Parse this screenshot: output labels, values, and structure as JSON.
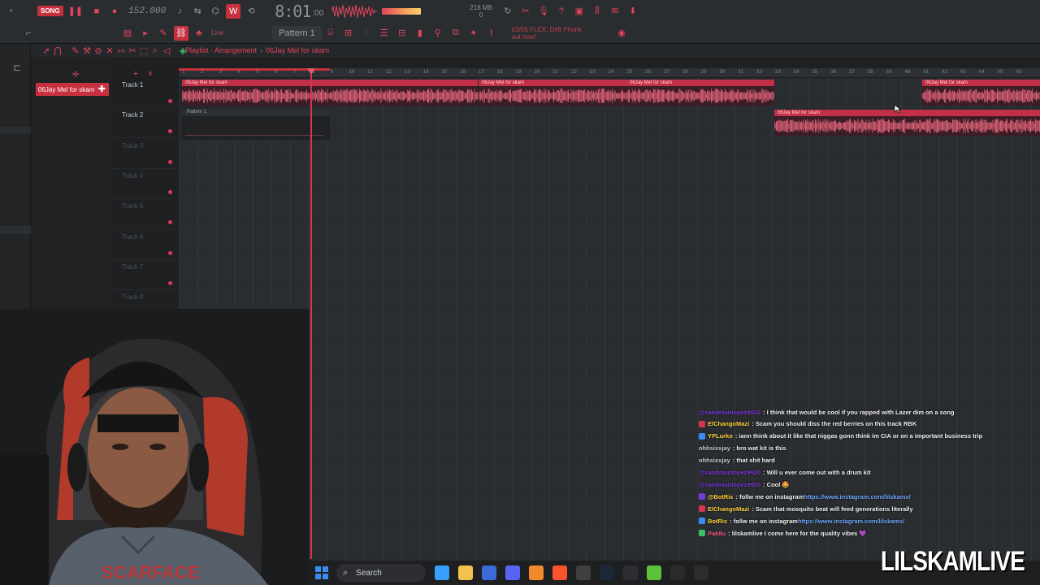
{
  "toolbar": {
    "song_label": "SONG",
    "bpm": "152.000",
    "clock_main": "8:01",
    "clock_sub": ":00",
    "memory_top": "218 MB",
    "memory_bottom": "0",
    "line_mode": "Line",
    "pattern_selector": "Pattern 1",
    "hint_line1": "03/06  FLEX: Drift Phonk",
    "hint_line2": "out now!"
  },
  "playlist": {
    "title": "Playlist - Arrangement",
    "separator": "›",
    "subtitle": "06Jay Mel for skam",
    "selected_clip": "06Jay Mel for skam"
  },
  "ruler_ticks": [
    "1",
    "2",
    "3",
    "4",
    "5",
    "6",
    "7",
    "8",
    "9",
    "10",
    "11",
    "12",
    "13",
    "14",
    "15",
    "16",
    "17",
    "18",
    "19",
    "20",
    "21",
    "22",
    "23",
    "24",
    "25",
    "26",
    "27",
    "28",
    "29",
    "30",
    "31",
    "32",
    "33",
    "34",
    "35",
    "36",
    "37",
    "38",
    "39",
    "40",
    "41",
    "42",
    "43",
    "44",
    "45",
    "46"
  ],
  "tracks": [
    {
      "name": "Track 1"
    },
    {
      "name": "Track 2"
    },
    {
      "name": "Track 3"
    },
    {
      "name": "Track 4"
    },
    {
      "name": "Track 5"
    },
    {
      "name": "Track 6"
    },
    {
      "name": "Track 7"
    },
    {
      "name": "Track 8"
    }
  ],
  "clips": {
    "audio_label": "06Jay Mel for skam",
    "pattern_label": "Pattern 1"
  },
  "chat": [
    {
      "user": "@sandmanlopez9920",
      "user_color": "#7b3ad6",
      "msg": ": I think that would be cool if you rapped with Lazer dim on a song"
    },
    {
      "user": "ElChangoMazi",
      "user_color": "#ffd23f",
      "badge": "#d8354f",
      "msg": ": Scam you should diss the red berries on this track RBK"
    },
    {
      "user": "YPLurko",
      "user_color": "#ffd23f",
      "badge": "#3b8df1",
      "msg": ": iann think about it like that niggas gonn think im CIA or on a important business trip"
    },
    {
      "user": "ohhsixxjay",
      "user_color": "#d0d0d0",
      "msg": ": bro wat kit is this"
    },
    {
      "user": "ohhsixxjay",
      "user_color": "#d0d0d0",
      "msg": ": that shit hard"
    },
    {
      "user": "@sandmanlopez9920",
      "user_color": "#7b3ad6",
      "msg": ": Will u ever come out with a drum kit"
    },
    {
      "user": "@sandmanlopez9920",
      "user_color": "#7b3ad6",
      "msg": ": Cool 🤩"
    },
    {
      "user": "@BotRix",
      "user_color": "#ffd23f",
      "badge": "#6c3fd6",
      "msg": ": follw me on instagram ",
      "link": "https://www.instagram.com/lilskamx/"
    },
    {
      "user": "ElChangoMazi",
      "user_color": "#ffd23f",
      "badge": "#d8354f",
      "msg": ": Scam that mosquito beat will feed generations literally"
    },
    {
      "user": "BotRix",
      "user_color": "#ffd23f",
      "badge": "#3b8df1",
      "msg": ": follw me on instagram ",
      "link": "https://www.instagram.com/lilskamx/"
    },
    {
      "user": "Pak8u",
      "user_color": "#ff5a8a",
      "badge": "#35c46a",
      "msg": ": lilskamlive I come here for the quality vibes 💜"
    }
  ],
  "taskbar": {
    "search_label": "Search",
    "apps": [
      "copilot-icon",
      "file-explorer-icon",
      "store-icon",
      "discord-icon",
      "fl-studio-icon",
      "brave-icon",
      "obs-icon",
      "steam-icon",
      "app-icon",
      "bluestacks-icon",
      "capcut-icon",
      "epic-icon"
    ]
  },
  "overlay": {
    "brand": "LILSKAMLIVE"
  },
  "colors": {
    "accent": "#d8354f",
    "clip_header": "#c23048",
    "clip_body": "#3a1d25"
  }
}
